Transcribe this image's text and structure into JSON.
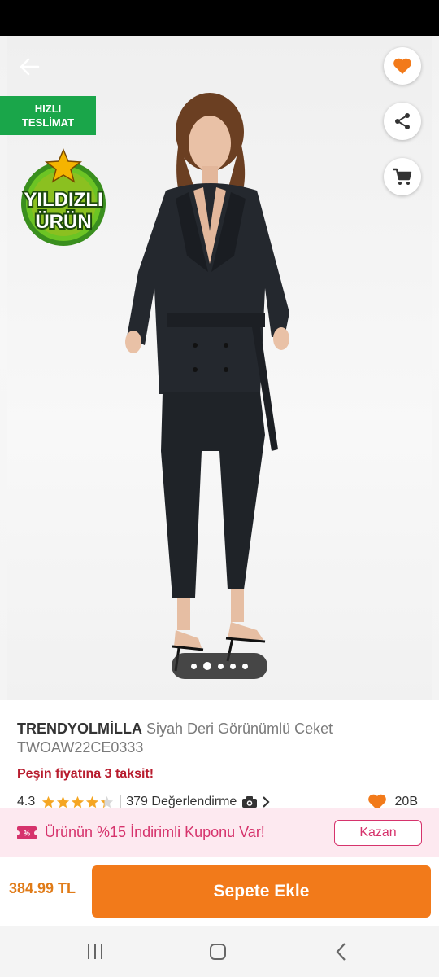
{
  "hero": {
    "fast_badge_line1": "HIZLI",
    "fast_badge_line2": "TESLİMAT",
    "star_badge_line1": "YILDIZLI",
    "star_badge_line2": "ÜRÜN",
    "carousel": {
      "count": 5,
      "active_index": 1
    },
    "icons": {
      "back": "arrow-left-icon",
      "favorite": "heart-icon",
      "share": "share-icon",
      "cart": "cart-icon"
    }
  },
  "product": {
    "brand": "TRENDYOLMİLLA",
    "name": "Siyah Deri Görünümlü Ceket TWOAW22CE0333",
    "installment": "Peşin fiyatına 3 taksit!",
    "rating": "4.3",
    "stars_value": 4.3,
    "review_count": "379 Değerlendirme",
    "favorites": "20B"
  },
  "coupon": {
    "text": "Ürünün %15 İndirimli Kuponu Var!",
    "button": "Kazan"
  },
  "footer": {
    "price": "384.99 TL",
    "add_to_cart": "Sepete Ekle"
  },
  "colors": {
    "accent": "#f27a1a",
    "coupon_pink": "#d6336c",
    "fast_green": "#1aa64a",
    "installment_red": "#b81c2e"
  }
}
